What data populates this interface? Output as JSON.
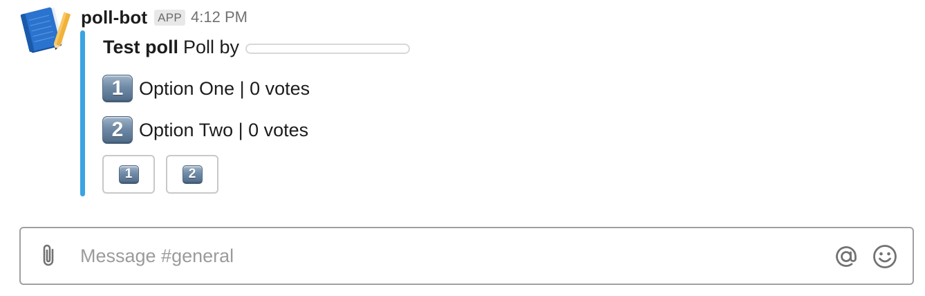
{
  "message": {
    "bot_name": "poll-bot",
    "badge": "APP",
    "timestamp": "4:12 PM",
    "avatar_icon": "notebook-icon"
  },
  "poll": {
    "title": "Test poll",
    "by_text": "Poll by",
    "options": [
      {
        "number": "1",
        "label": "Option One | 0 votes"
      },
      {
        "number": "2",
        "label": "Option Two | 0 votes"
      }
    ],
    "buttons": [
      {
        "number": "1"
      },
      {
        "number": "2"
      }
    ]
  },
  "composer": {
    "placeholder": "Message #general",
    "icons": [
      "paperclip-icon",
      "at-sign-icon",
      "smiley-icon"
    ]
  },
  "colors": {
    "attachment_bar": "#3aa3e3",
    "badge_bg": "#e8e8e8",
    "timestamp": "#717171"
  }
}
